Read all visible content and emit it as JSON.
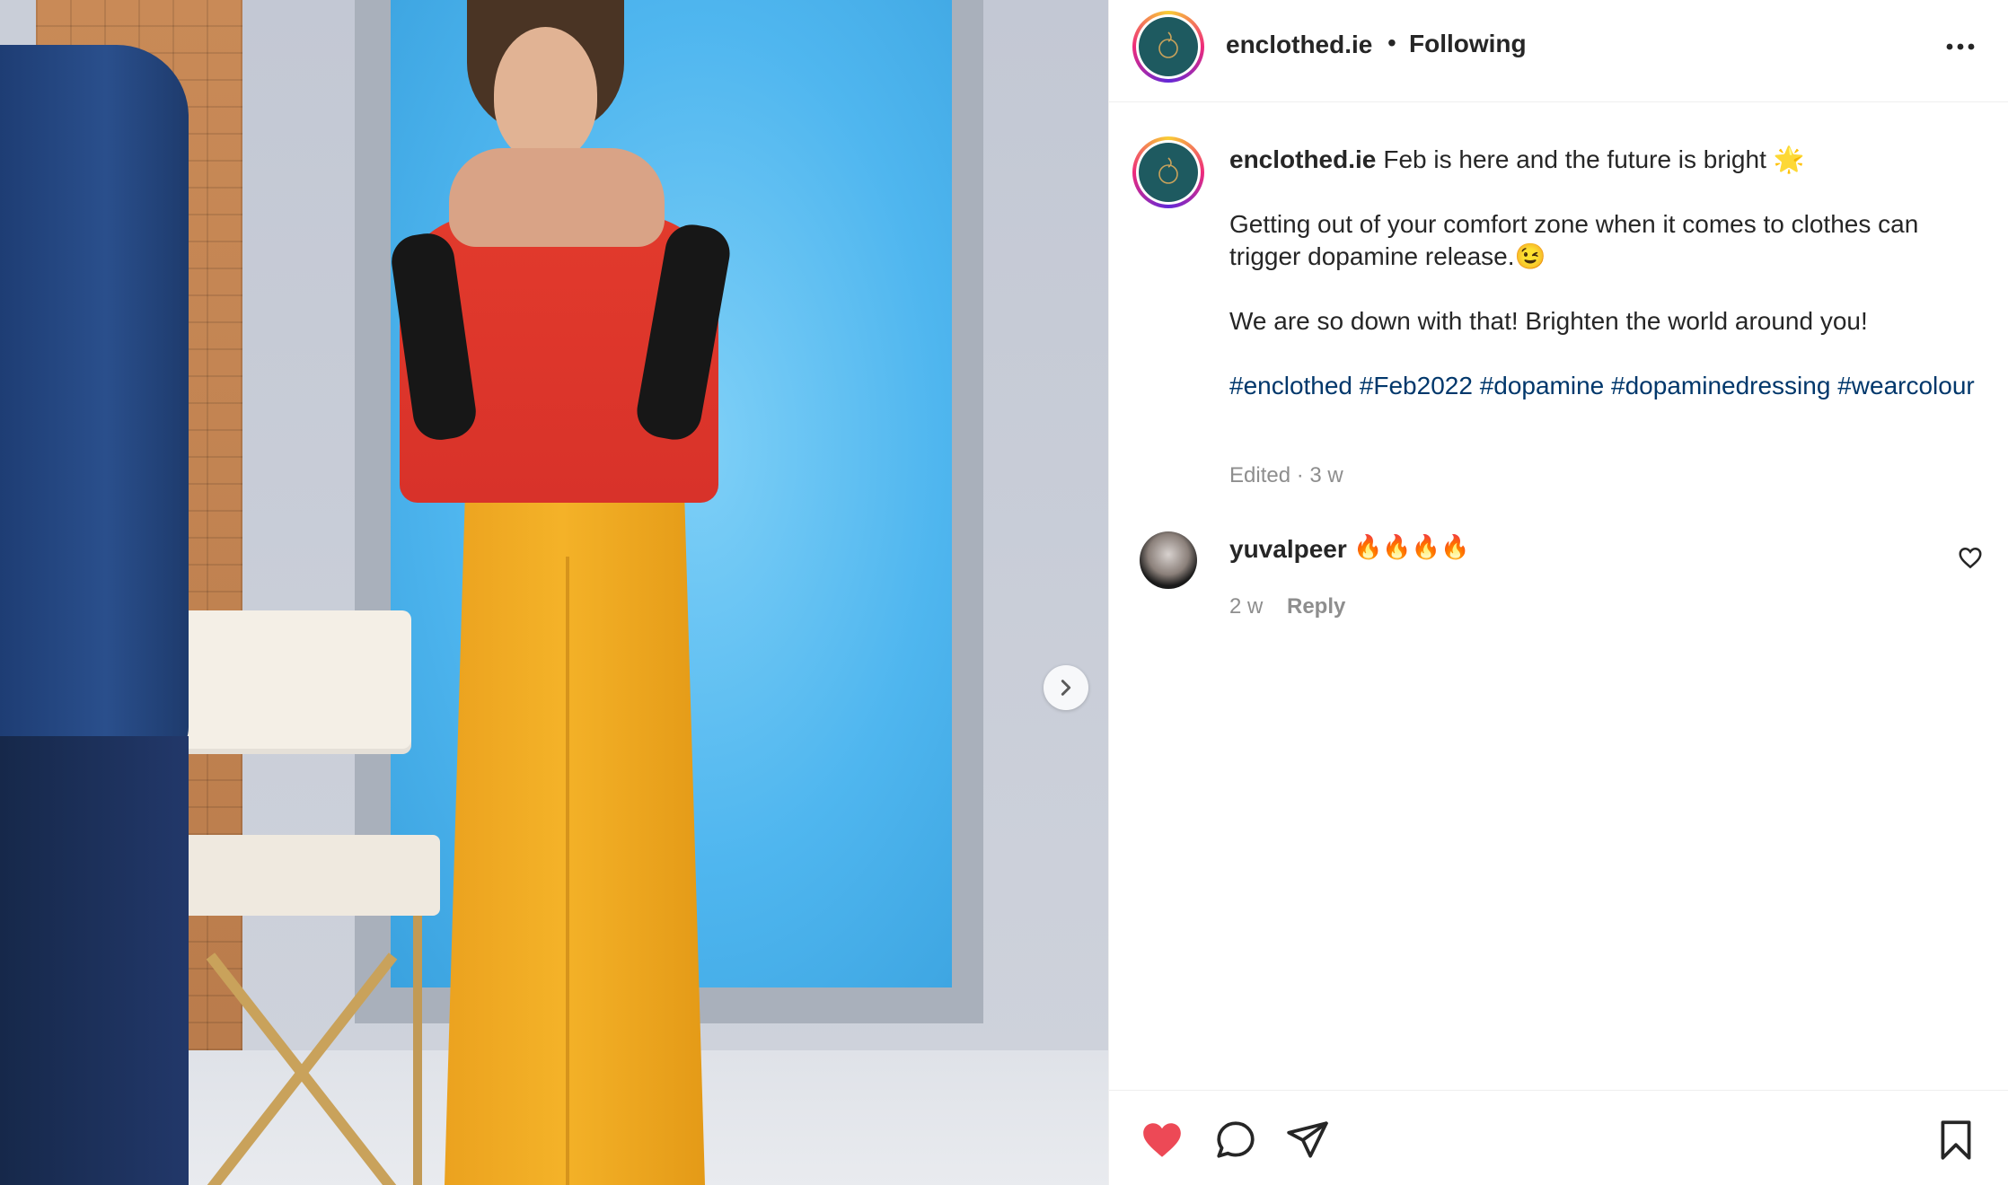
{
  "post": {
    "username": "enclothed.ie",
    "separator": "•",
    "follow_status": "Following"
  },
  "caption": {
    "username": "enclothed.ie",
    "line1": "Feb is here and the future is bright 🌟",
    "line2": "Getting out of your comfort zone when it comes to clothes can trigger dopamine release.😉",
    "line3": "We are so down with that! Brighten the world around you!",
    "hashtags": [
      "#enclothed",
      "#Feb2022",
      "#dopamine",
      "#dopaminedressing",
      "#wearcolour"
    ],
    "meta": "Edited · 3 w"
  },
  "comment": {
    "username": "yuvalpeer",
    "text": "🔥🔥🔥🔥",
    "time": "2 w",
    "reply_label": "Reply"
  },
  "icons": {
    "like": "heart-filled-icon",
    "comment": "comment-bubble-icon",
    "share": "paper-plane-icon",
    "save": "bookmark-icon",
    "more": "more-dots-icon",
    "next": "chevron-right-icon"
  },
  "colors": {
    "like_red": "#ed4956",
    "hashtag_blue": "#00376b",
    "muted_gray": "#8e8e8e",
    "text_dark": "#262626"
  }
}
